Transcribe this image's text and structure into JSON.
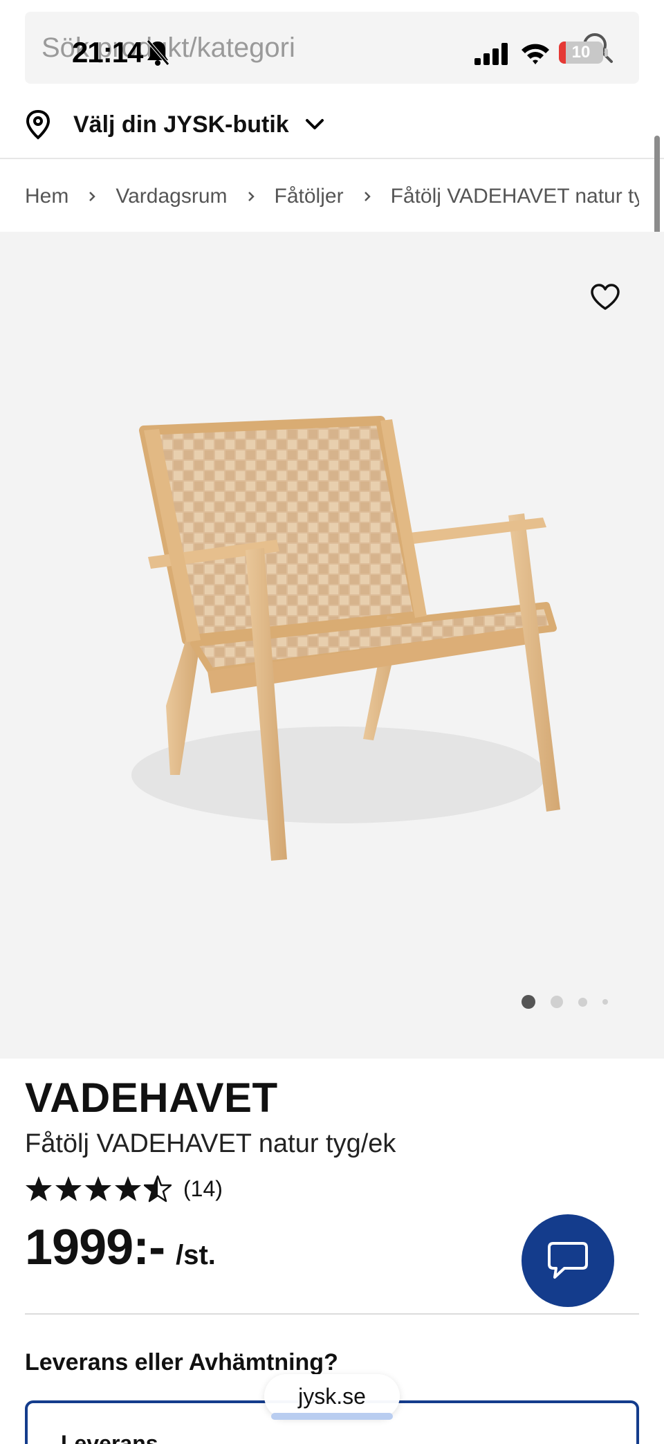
{
  "status_bar": {
    "time": "21:14",
    "battery_level": "10"
  },
  "search": {
    "placeholder": "Sök produkt/kategori"
  },
  "store": {
    "label": "Välj din JYSK-butik"
  },
  "breadcrumb": [
    "Hem",
    "Vardagsrum",
    "Fåtöljer",
    "Fåtölj VADEHAVET natur tyg/ek"
  ],
  "gallery": {
    "image_count": 4,
    "active_index": 0
  },
  "product": {
    "brand": "VADEHAVET",
    "name": "Fåtölj VADEHAVET natur tyg/ek",
    "rating": 4.5,
    "review_count": "(14)",
    "price": "1999:-",
    "unit": "/st."
  },
  "delivery": {
    "heading": "Leverans eller Avhämtning?",
    "option": "Leverans"
  },
  "browser": {
    "url": "jysk.se"
  },
  "colors": {
    "accent": "#143c8c",
    "battery_low": "#e53935"
  },
  "icons": [
    "search-icon",
    "bell-slash-icon",
    "signal-icon",
    "wifi-icon",
    "battery-icon",
    "location-pin-icon",
    "chevron-down-icon",
    "chevron-right-icon",
    "heart-icon",
    "star-icon",
    "chat-bubble-icon"
  ]
}
